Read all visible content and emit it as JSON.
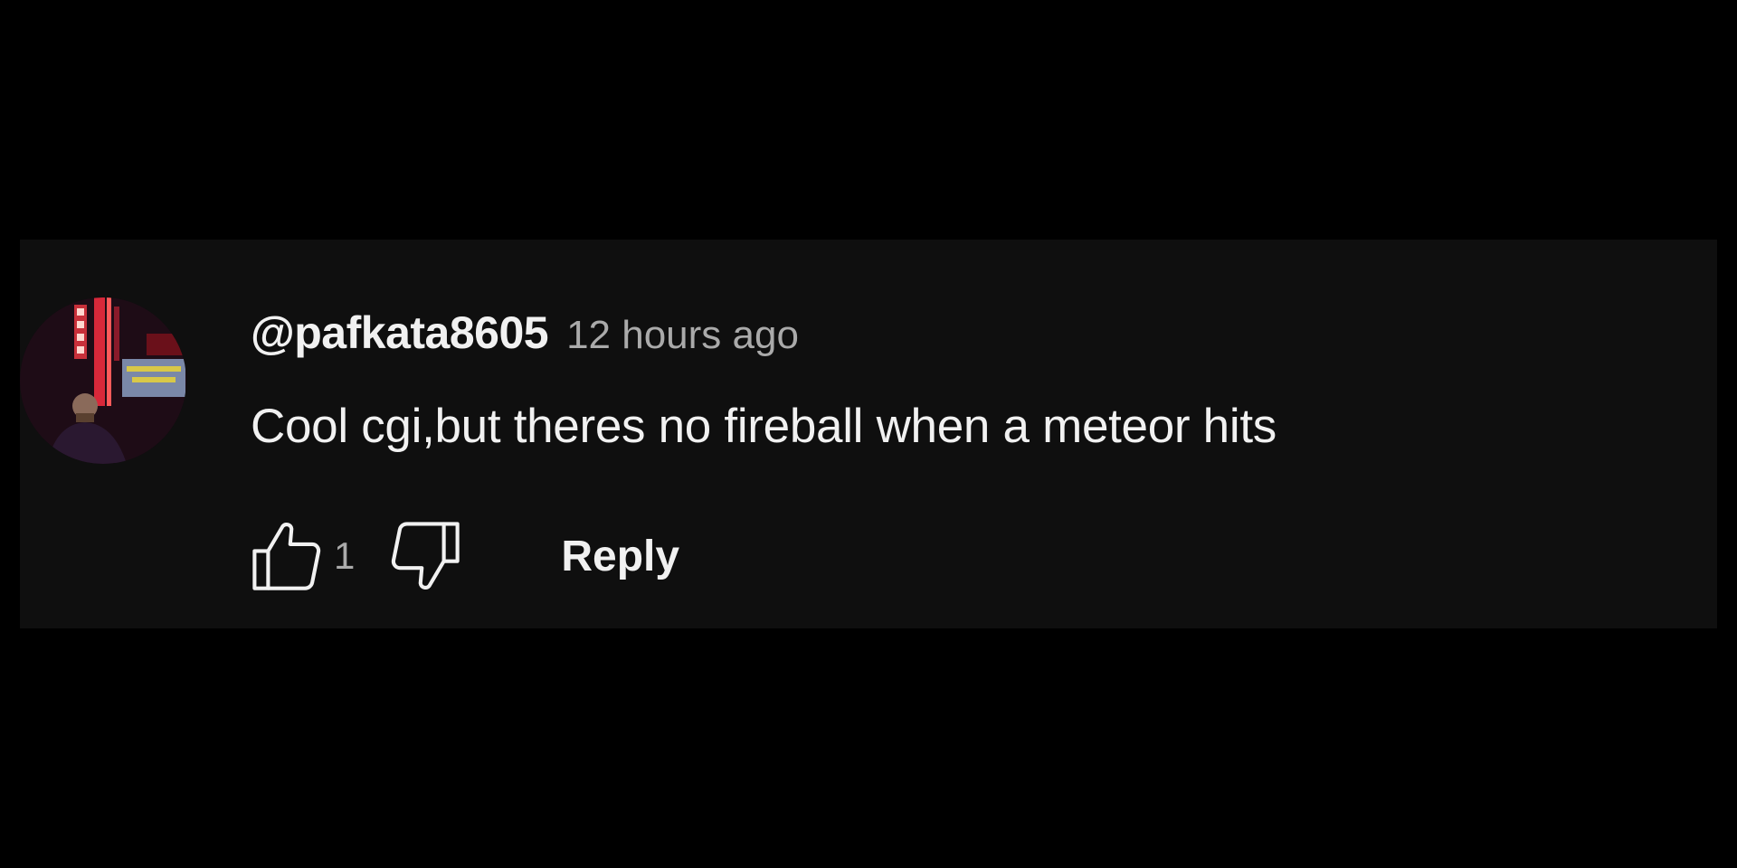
{
  "comment": {
    "author": "@pafkata8605",
    "timestamp": "12 hours ago",
    "text": "Cool cgi,but theres no fireball when a meteor hits",
    "like_count": "1",
    "reply_label": "Reply"
  },
  "icons": {
    "like": "thumbs-up-icon",
    "dislike": "thumbs-down-icon"
  },
  "colors": {
    "page_background": "#000000",
    "card_background": "#0f0f0f",
    "primary_text": "#f1f1f1",
    "secondary_text": "#aaaaaa"
  }
}
